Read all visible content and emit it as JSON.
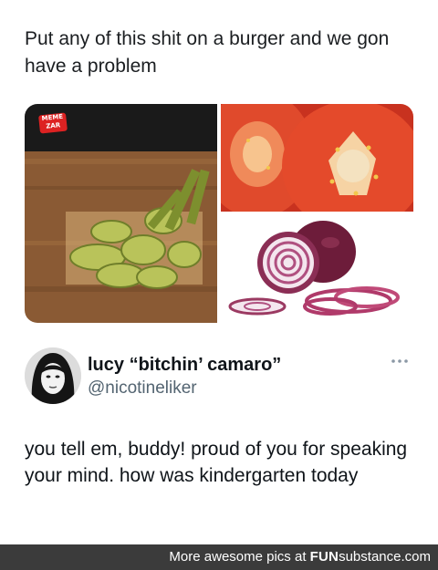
{
  "post": {
    "text": "Put any of this shit on a burger and we gon have a problem"
  },
  "media": {
    "watermark_line1": "MEME",
    "watermark_line2": "ZAR",
    "images": [
      "pickles-icon",
      "tomato-icon",
      "red-onion-icon"
    ]
  },
  "reply": {
    "display_name": "lucy “bitchin’ camaro”",
    "handle": "@nicotineliker",
    "text": "you tell em, buddy! proud of you for speaking your mind. how was kindergarten today",
    "more_icon": "more-horizontal-icon"
  },
  "footer": {
    "prefix": "More awesome pics at ",
    "brand_fun": "FUN",
    "brand_rest": "substance",
    "suffix": ".com",
    "background": "#3b3b3b"
  }
}
